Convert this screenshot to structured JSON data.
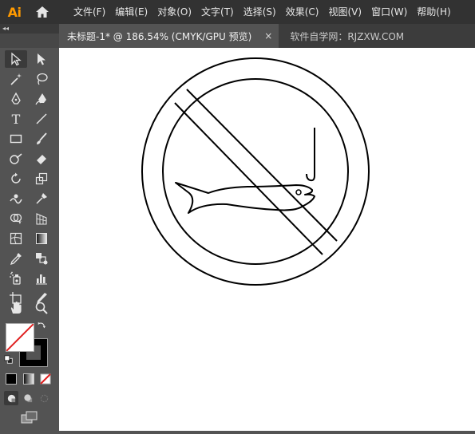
{
  "app": {
    "logo_text": "Ai"
  },
  "menu": {
    "items": [
      {
        "label": "文件(F)"
      },
      {
        "label": "编辑(E)"
      },
      {
        "label": "对象(O)"
      },
      {
        "label": "文字(T)"
      },
      {
        "label": "选择(S)"
      },
      {
        "label": "效果(C)"
      },
      {
        "label": "视图(V)"
      },
      {
        "label": "窗口(W)"
      },
      {
        "label": "帮助(H)"
      }
    ]
  },
  "panel_collapse": "◂◂",
  "tabs": {
    "active": {
      "title": "未标题-1* @ 186.54% (CMYK/GPU 预览)",
      "close": "×"
    },
    "inactive": {
      "title": "软件自学网：RJZXW.COM"
    }
  },
  "tools": {
    "type_glyph": "T",
    "icons": [
      "selection-tool-icon",
      "direct-selection-tool-icon",
      "magic-wand-tool-icon",
      "lasso-tool-icon",
      "pen-tool-icon",
      "curvature-tool-icon",
      "type-tool-icon",
      "line-segment-tool-icon",
      "rectangle-tool-icon",
      "paintbrush-tool-icon",
      "shaper-tool-icon",
      "eraser-tool-icon",
      "rotate-tool-icon",
      "scale-tool-icon",
      "warp-tool-icon",
      "puppet-warp-tool-icon",
      "shape-builder-tool-icon",
      "perspective-grid-tool-icon",
      "mesh-tool-icon",
      "gradient-tool-icon",
      "eyedropper-tool-icon",
      "blend-tool-icon",
      "symbol-sprayer-tool-icon",
      "column-graph-tool-icon",
      "artboard-tool-icon",
      "slice-tool-icon",
      "hand-tool-icon",
      "zoom-tool-icon"
    ]
  },
  "colors": {
    "app_bg": "#535353",
    "menubar_bg": "#323232",
    "logo": "#ff9a00",
    "canvas": "#ffffff",
    "drawing_stroke": "#000000",
    "none_slash": "#e02020"
  }
}
